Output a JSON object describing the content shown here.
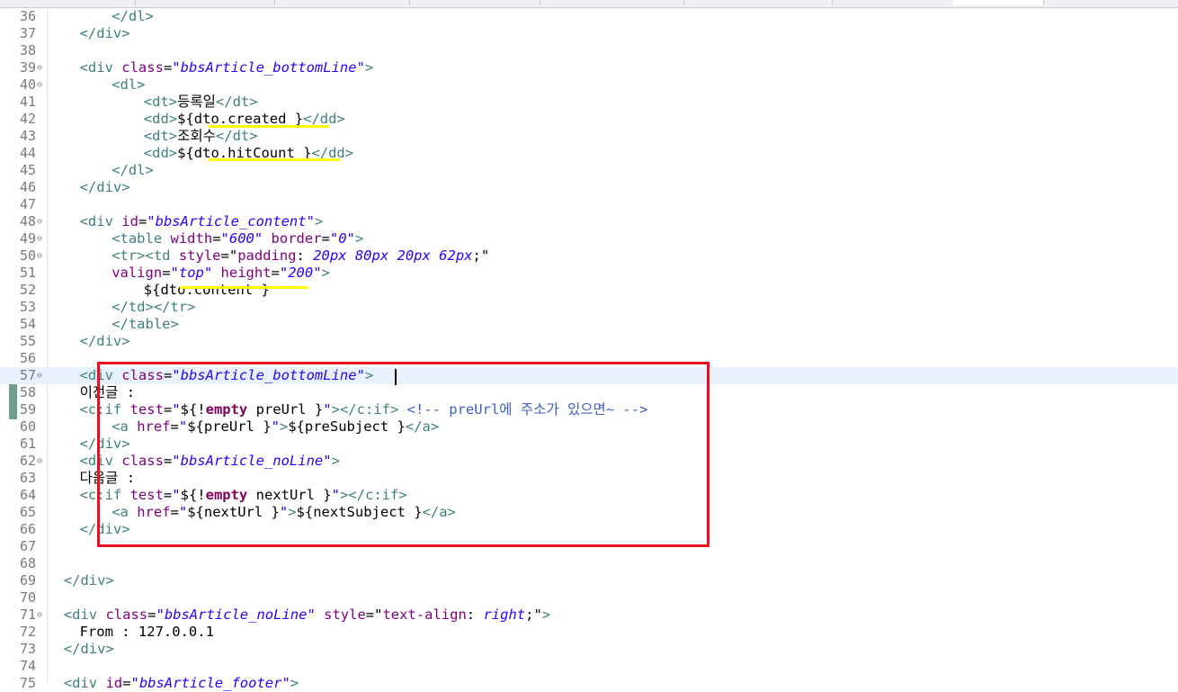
{
  "editor": {
    "lines": [
      {
        "num": "36",
        "fold": "",
        "indent": 4,
        "segs": [
          {
            "c": "tg",
            "t": "</dl>"
          }
        ]
      },
      {
        "num": "37",
        "fold": "",
        "indent": 2,
        "segs": [
          {
            "c": "tg",
            "t": "</div>"
          }
        ]
      },
      {
        "num": "38",
        "fold": "",
        "indent": 0,
        "segs": []
      },
      {
        "num": "39",
        "fold": "⊖",
        "indent": 2,
        "segs": [
          {
            "c": "tg",
            "t": "<div "
          },
          {
            "c": "at",
            "t": "class"
          },
          {
            "c": "op",
            "t": "="
          },
          {
            "c": "av",
            "t": "\"bbsArticle_bottomLine\""
          },
          {
            "c": "tg",
            "t": ">"
          }
        ]
      },
      {
        "num": "40",
        "fold": "⊖",
        "indent": 4,
        "segs": [
          {
            "c": "tg",
            "t": "<dl>"
          }
        ]
      },
      {
        "num": "41",
        "fold": "",
        "indent": 6,
        "segs": [
          {
            "c": "tg",
            "t": "<dt>"
          },
          {
            "c": "tx",
            "t": "등록일"
          },
          {
            "c": "tg",
            "t": "</dt>"
          }
        ]
      },
      {
        "num": "42",
        "fold": "",
        "indent": 6,
        "segs": [
          {
            "c": "tg",
            "t": "<dd>"
          },
          {
            "c": "tx",
            "t": "${dto.created }"
          },
          {
            "c": "tg",
            "t": "</dd>"
          }
        ]
      },
      {
        "num": "43",
        "fold": "",
        "indent": 6,
        "segs": [
          {
            "c": "tg",
            "t": "<dt>"
          },
          {
            "c": "tx",
            "t": "조회수"
          },
          {
            "c": "tg",
            "t": "</dt>"
          }
        ]
      },
      {
        "num": "44",
        "fold": "",
        "indent": 6,
        "segs": [
          {
            "c": "tg",
            "t": "<dd>"
          },
          {
            "c": "tx",
            "t": "${dto.hitCount }"
          },
          {
            "c": "tg",
            "t": "</dd>"
          }
        ]
      },
      {
        "num": "45",
        "fold": "",
        "indent": 4,
        "segs": [
          {
            "c": "tg",
            "t": "</dl>"
          }
        ]
      },
      {
        "num": "46",
        "fold": "",
        "indent": 2,
        "segs": [
          {
            "c": "tg",
            "t": "</div>"
          }
        ]
      },
      {
        "num": "47",
        "fold": "",
        "indent": 0,
        "segs": []
      },
      {
        "num": "48",
        "fold": "⊖",
        "indent": 2,
        "segs": [
          {
            "c": "tg",
            "t": "<div "
          },
          {
            "c": "at",
            "t": "id"
          },
          {
            "c": "op",
            "t": "="
          },
          {
            "c": "av",
            "t": "\"bbsArticle_content\""
          },
          {
            "c": "tg",
            "t": ">"
          }
        ]
      },
      {
        "num": "49",
        "fold": "⊖",
        "indent": 4,
        "segs": [
          {
            "c": "tg",
            "t": "<table "
          },
          {
            "c": "at",
            "t": "width"
          },
          {
            "c": "op",
            "t": "="
          },
          {
            "c": "av",
            "t": "\"600\" "
          },
          {
            "c": "at",
            "t": "border"
          },
          {
            "c": "op",
            "t": "="
          },
          {
            "c": "av",
            "t": "\"0\""
          },
          {
            "c": "tg",
            "t": ">"
          }
        ]
      },
      {
        "num": "50",
        "fold": "⊖",
        "indent": 4,
        "segs": [
          {
            "c": "tg",
            "t": "<tr><td "
          },
          {
            "c": "at",
            "t": "style"
          },
          {
            "c": "op",
            "t": "=\""
          },
          {
            "c": "at",
            "t": "padding"
          },
          {
            "c": "op",
            "t": ": "
          },
          {
            "c": "av",
            "t": "20px 80px 20px 62px"
          },
          {
            "c": "op",
            "t": ";\""
          }
        ]
      },
      {
        "num": "51",
        "fold": "",
        "indent": 4,
        "segs": [
          {
            "c": "at",
            "t": "valign"
          },
          {
            "c": "op",
            "t": "="
          },
          {
            "c": "av",
            "t": "\"top\" "
          },
          {
            "c": "at",
            "t": "height"
          },
          {
            "c": "op",
            "t": "="
          },
          {
            "c": "av",
            "t": "\"200\""
          },
          {
            "c": "tg",
            "t": ">"
          }
        ]
      },
      {
        "num": "52",
        "fold": "",
        "indent": 6,
        "segs": [
          {
            "c": "tx",
            "t": "${dto.content }"
          }
        ]
      },
      {
        "num": "53",
        "fold": "",
        "indent": 4,
        "segs": [
          {
            "c": "tg",
            "t": "</td></tr>"
          }
        ]
      },
      {
        "num": "54",
        "fold": "",
        "indent": 4,
        "segs": [
          {
            "c": "tg",
            "t": "</table>"
          }
        ]
      },
      {
        "num": "55",
        "fold": "",
        "indent": 2,
        "segs": [
          {
            "c": "tg",
            "t": "</div>"
          }
        ]
      },
      {
        "num": "56",
        "fold": "",
        "indent": 0,
        "segs": []
      },
      {
        "num": "57",
        "fold": "⊖",
        "indent": 2,
        "segs": [
          {
            "c": "tg",
            "t": "<div "
          },
          {
            "c": "at",
            "t": "class"
          },
          {
            "c": "op",
            "t": "="
          },
          {
            "c": "av",
            "t": "\"bbsArticle_bottomLine\""
          },
          {
            "c": "tg",
            "t": ">"
          }
        ]
      },
      {
        "num": "58",
        "fold": "",
        "indent": 2,
        "segs": [
          {
            "c": "tx",
            "t": "이전글 :"
          }
        ]
      },
      {
        "num": "59",
        "fold": "",
        "indent": 2,
        "segs": [
          {
            "c": "tg",
            "t": "<c:if "
          },
          {
            "c": "at",
            "t": "test"
          },
          {
            "c": "op",
            "t": "="
          },
          {
            "c": "sv",
            "t": "\""
          },
          {
            "c": "op",
            "t": "${!"
          },
          {
            "c": "kw",
            "t": "empty"
          },
          {
            "c": "op",
            "t": " preUrl }"
          },
          {
            "c": "sv",
            "t": "\""
          },
          {
            "c": "tg",
            "t": "></c:if> "
          },
          {
            "c": "cm",
            "t": "<!-- preUrl에 주소가 있으면~ -->"
          }
        ]
      },
      {
        "num": "60",
        "fold": "",
        "indent": 4,
        "segs": [
          {
            "c": "tg",
            "t": "<a "
          },
          {
            "c": "at",
            "t": "href"
          },
          {
            "c": "op",
            "t": "="
          },
          {
            "c": "sv",
            "t": "\""
          },
          {
            "c": "op",
            "t": "${preUrl }"
          },
          {
            "c": "sv",
            "t": "\""
          },
          {
            "c": "tg",
            "t": ">"
          },
          {
            "c": "tx",
            "t": "${preSubject }"
          },
          {
            "c": "tg",
            "t": "</a>"
          }
        ]
      },
      {
        "num": "61",
        "fold": "",
        "indent": 2,
        "segs": [
          {
            "c": "tg",
            "t": "</div>"
          }
        ]
      },
      {
        "num": "62",
        "fold": "⊖",
        "indent": 2,
        "segs": [
          {
            "c": "tg",
            "t": "<div "
          },
          {
            "c": "at",
            "t": "class"
          },
          {
            "c": "op",
            "t": "="
          },
          {
            "c": "av",
            "t": "\"bbsArticle_noLine\""
          },
          {
            "c": "tg",
            "t": ">"
          }
        ]
      },
      {
        "num": "63",
        "fold": "",
        "indent": 2,
        "segs": [
          {
            "c": "tx",
            "t": "다음글 :"
          }
        ]
      },
      {
        "num": "64",
        "fold": "",
        "indent": 2,
        "segs": [
          {
            "c": "tg",
            "t": "<c:if "
          },
          {
            "c": "at",
            "t": "test"
          },
          {
            "c": "op",
            "t": "="
          },
          {
            "c": "sv",
            "t": "\""
          },
          {
            "c": "op",
            "t": "${!"
          },
          {
            "c": "kw",
            "t": "empty"
          },
          {
            "c": "op",
            "t": " nextUrl }"
          },
          {
            "c": "sv",
            "t": "\""
          },
          {
            "c": "tg",
            "t": "></c:if>"
          }
        ]
      },
      {
        "num": "65",
        "fold": "",
        "indent": 4,
        "segs": [
          {
            "c": "tg",
            "t": "<a "
          },
          {
            "c": "at",
            "t": "href"
          },
          {
            "c": "op",
            "t": "="
          },
          {
            "c": "sv",
            "t": "\""
          },
          {
            "c": "op",
            "t": "${nextUrl }"
          },
          {
            "c": "sv",
            "t": "\""
          },
          {
            "c": "tg",
            "t": ">"
          },
          {
            "c": "tx",
            "t": "${nextSubject }"
          },
          {
            "c": "tg",
            "t": "</a>"
          }
        ]
      },
      {
        "num": "66",
        "fold": "",
        "indent": 2,
        "segs": [
          {
            "c": "tg",
            "t": "</div>"
          }
        ]
      },
      {
        "num": "67",
        "fold": "",
        "indent": 0,
        "segs": []
      },
      {
        "num": "68",
        "fold": "",
        "indent": 0,
        "segs": []
      },
      {
        "num": "69",
        "fold": "",
        "indent": 1,
        "segs": [
          {
            "c": "tg",
            "t": "</div>"
          }
        ]
      },
      {
        "num": "70",
        "fold": "",
        "indent": 0,
        "segs": []
      },
      {
        "num": "71",
        "fold": "⊖",
        "indent": 1,
        "segs": [
          {
            "c": "tg",
            "t": "<div "
          },
          {
            "c": "at",
            "t": "class"
          },
          {
            "c": "op",
            "t": "="
          },
          {
            "c": "av",
            "t": "\"bbsArticle_noLine\" "
          },
          {
            "c": "at",
            "t": "style"
          },
          {
            "c": "op",
            "t": "=\""
          },
          {
            "c": "at",
            "t": "text-align"
          },
          {
            "c": "op",
            "t": ": "
          },
          {
            "c": "av",
            "t": "right"
          },
          {
            "c": "op",
            "t": ";\""
          },
          {
            "c": "tg",
            "t": ">"
          }
        ]
      },
      {
        "num": "72",
        "fold": "",
        "indent": 2,
        "segs": [
          {
            "c": "tx",
            "t": "From : 127.0.0.1"
          }
        ]
      },
      {
        "num": "73",
        "fold": "",
        "indent": 1,
        "segs": [
          {
            "c": "tg",
            "t": "</div>"
          }
        ]
      },
      {
        "num": "74",
        "fold": "",
        "indent": 0,
        "segs": []
      },
      {
        "num": "75",
        "fold": "",
        "indent": 1,
        "segs": [
          {
            "c": "tg",
            "t": "<div "
          },
          {
            "c": "at",
            "t": "id"
          },
          {
            "c": "op",
            "t": "="
          },
          {
            "c": "av",
            "t": "\"bbsArticle_footer\""
          },
          {
            "c": "tg",
            "t": ">"
          }
        ]
      }
    ],
    "current_line": "57",
    "highlight_color": "#ffff00",
    "annotation_color": "#e8121e"
  }
}
